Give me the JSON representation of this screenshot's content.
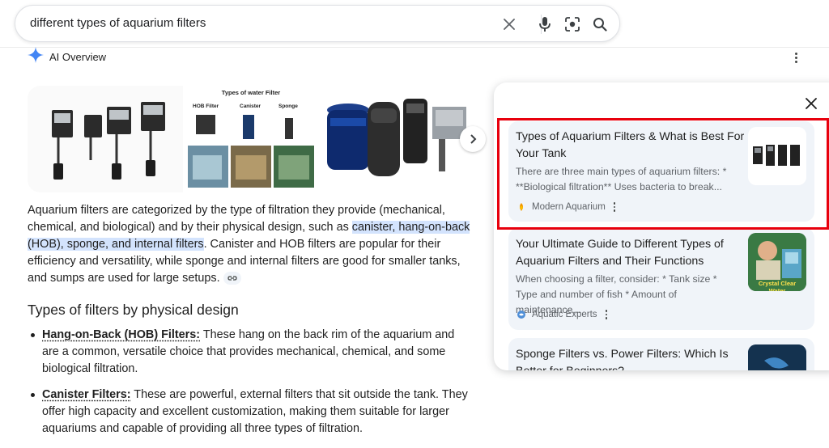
{
  "search": {
    "query": "different types of aquarium filters"
  },
  "ai_overview": {
    "label": "AI Overview",
    "image_tile_2_caption": "Types of water Filter",
    "image_tile_2_labels": [
      "HOB Filter",
      "Canister",
      "Sponge"
    ],
    "paragraph": {
      "part1": "Aquarium filters are categorized by the type of filtration they provide (mechanical, chemical, and biological) and by their physical design, such as ",
      "highlight": "canister, hang-on-back (HOB), sponge, and internal filters",
      "part2": ". Canister and HOB filters are popular for their efficiency and versatility, while sponge and internal filters are good for smaller tanks, and sumps are used for large setups."
    },
    "section_heading": "Types of filters by physical design",
    "bullets": [
      {
        "term": "Hang-on-Back (HOB) Filters:",
        "text": " These hang on the back rim of the aquarium and are a common, versatile choice that provides mechanical, chemical, and some biological filtration."
      },
      {
        "term": "Canister Filters:",
        "text": " These are powerful, external filters that sit outside the tank. They offer high capacity and excellent customization, making them suitable for larger aquariums and capable of providing all three types of filtration."
      }
    ]
  },
  "sources": [
    {
      "title": "Types of Aquarium Filters & What is Best For Your Tank",
      "snippet": "There are three main types of aquarium filters: * **Biological filtration** Uses bacteria to break...",
      "source": "Modern Aquarium"
    },
    {
      "title": "Your Ultimate Guide to Different Types of Aquarium Filters and Their Functions",
      "snippet": "When choosing a filter, consider: * Tank size * Type and number of fish * Amount of maintenance...",
      "source": "Aquatic Experts",
      "thumb_text": "Crystal Clear Water"
    },
    {
      "title": "Sponge Filters vs. Power Filters: Which Is Better for Beginners?"
    }
  ],
  "colors": {
    "highlight": "#d3e3fd",
    "card_bg": "#f0f4f9",
    "annotation_box": "#e8000d",
    "ai_sparkle": "#4285f4"
  }
}
